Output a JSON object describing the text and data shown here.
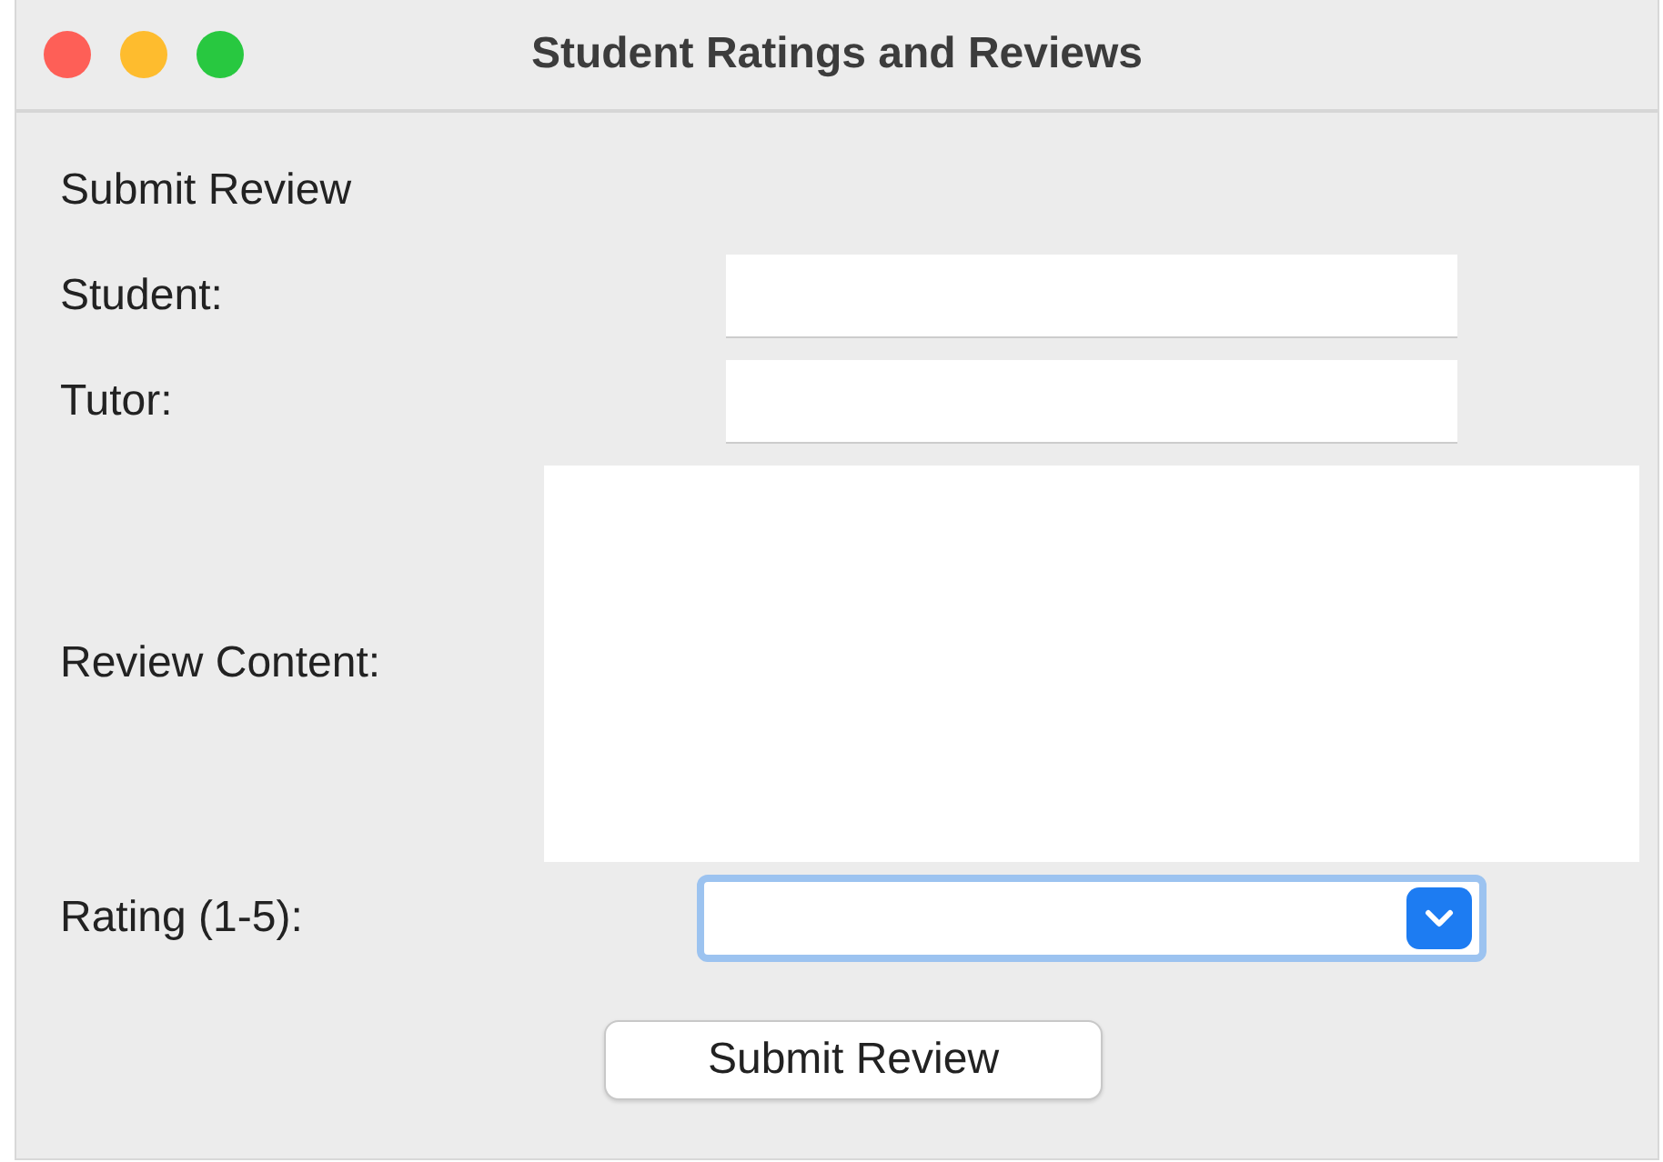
{
  "window": {
    "title": "Student Ratings and Reviews"
  },
  "heading": "Submit Review",
  "fields": [
    {
      "kind": "text",
      "label": "Student:"
    },
    {
      "kind": "text",
      "label": "Tutor:"
    },
    {
      "kind": "textarea",
      "label": "Review Content:"
    },
    {
      "kind": "combo",
      "label": "Rating (1-5):",
      "focused": true
    }
  ],
  "submit_button": "Submit Review"
}
